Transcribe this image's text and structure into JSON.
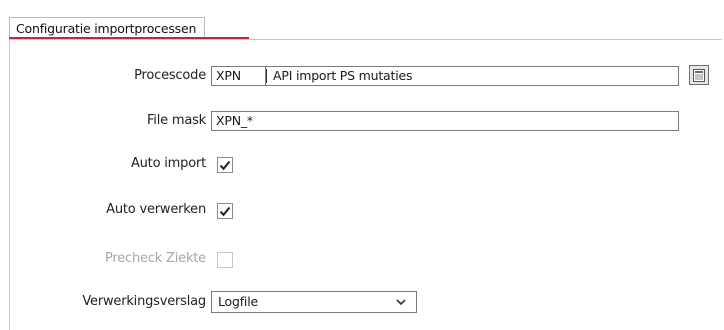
{
  "tab": {
    "title": "Configuratie importprocessen",
    "accent_color": "#c8243a"
  },
  "form": {
    "procescode": {
      "label": "Procescode",
      "code": "XPN",
      "description": "API import PS mutaties",
      "lookup_icon": "lookup-list-icon"
    },
    "file_mask": {
      "label": "File mask",
      "value": "XPN_*"
    },
    "auto_import": {
      "label": "Auto import",
      "checked": true
    },
    "auto_verwerken": {
      "label": "Auto verwerken",
      "checked": true
    },
    "precheck_ziekte": {
      "label": "Precheck Ziekte",
      "checked": false,
      "disabled": true
    },
    "verwerkingsverslag": {
      "label": "Verwerkingsverslag",
      "selected": "Logfile",
      "icon": "chevron-down-icon"
    }
  }
}
